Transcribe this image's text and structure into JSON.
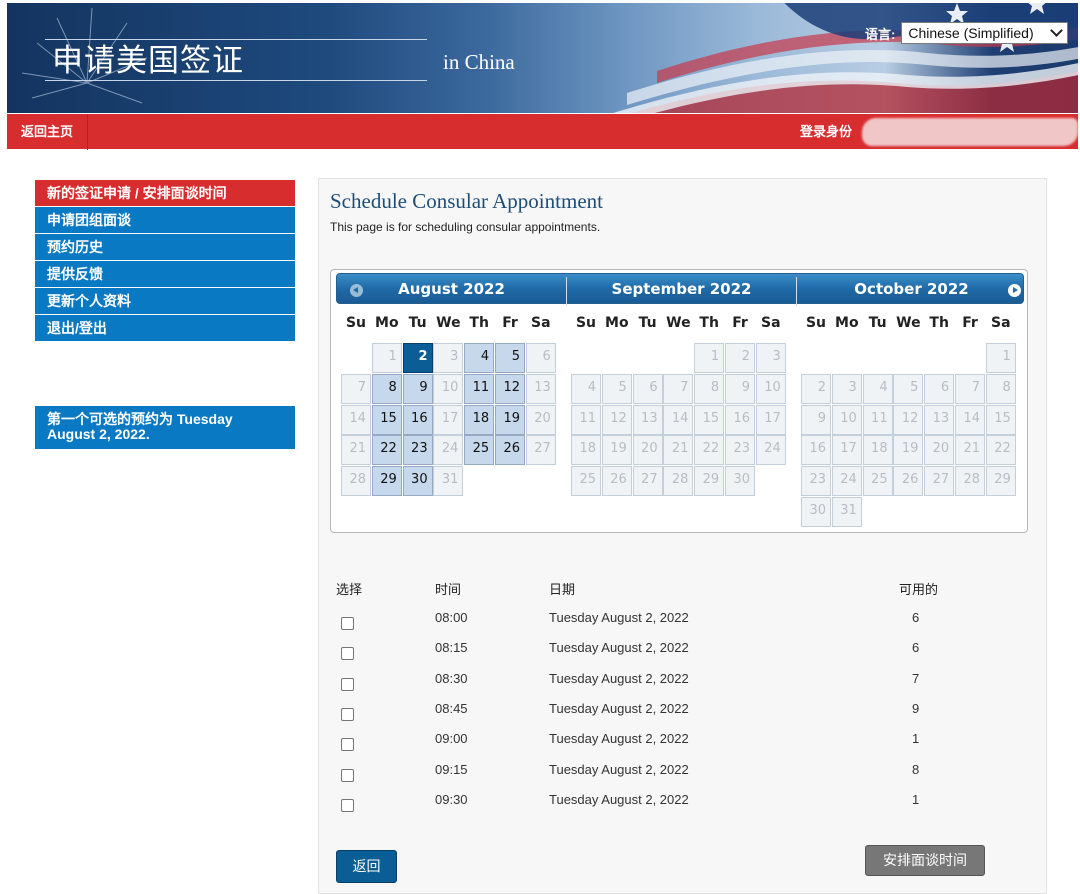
{
  "header": {
    "title": "申请美国签证",
    "subtitle": "in China",
    "language_label": "语言:",
    "language_value": "Chinese (Simplified)"
  },
  "nav": {
    "home": "返回主页",
    "login_label": "登录身份"
  },
  "sidebar": {
    "items": [
      {
        "label": "新的签证申请 / 安排面谈时间",
        "active": true
      },
      {
        "label": "申请团组面谈"
      },
      {
        "label": "预约历史"
      },
      {
        "label": "提供反馈"
      },
      {
        "label": "更新个人资料"
      },
      {
        "label": "退出/登出"
      }
    ],
    "first_available": "第一个可选的预约为 Tuesday August 2, 2022."
  },
  "main": {
    "title": "Schedule Consular Appointment",
    "subtitle": "This page is for scheduling consular appointments."
  },
  "calendar": {
    "weekdays": [
      "Su",
      "Mo",
      "Tu",
      "We",
      "Th",
      "Fr",
      "Sa"
    ],
    "months": [
      {
        "name": "August 2022",
        "first_weekday": 1,
        "days": 31,
        "available": [
          2,
          4,
          5,
          8,
          9,
          11,
          12,
          15,
          16,
          18,
          19,
          22,
          23,
          25,
          26,
          29,
          30
        ],
        "selected": 2
      },
      {
        "name": "September 2022",
        "first_weekday": 4,
        "days": 30,
        "available": [],
        "selected": null
      },
      {
        "name": "October 2022",
        "first_weekday": 6,
        "days": 31,
        "available": [],
        "selected": null
      }
    ]
  },
  "table": {
    "headers": {
      "select": "选择",
      "time": "时间",
      "date": "日期",
      "available": "可用的"
    },
    "rows": [
      {
        "time": "08:00",
        "date": "Tuesday August 2, 2022",
        "available": "6"
      },
      {
        "time": "08:15",
        "date": "Tuesday August 2, 2022",
        "available": "6"
      },
      {
        "time": "08:30",
        "date": "Tuesday August 2, 2022",
        "available": "7"
      },
      {
        "time": "08:45",
        "date": "Tuesday August 2, 2022",
        "available": "9"
      },
      {
        "time": "09:00",
        "date": "Tuesday August 2, 2022",
        "available": "1"
      },
      {
        "time": "09:15",
        "date": "Tuesday August 2, 2022",
        "available": "8"
      },
      {
        "time": "09:30",
        "date": "Tuesday August 2, 2022",
        "available": "1"
      }
    ]
  },
  "buttons": {
    "back": "返回",
    "schedule": "安排面谈时间"
  }
}
